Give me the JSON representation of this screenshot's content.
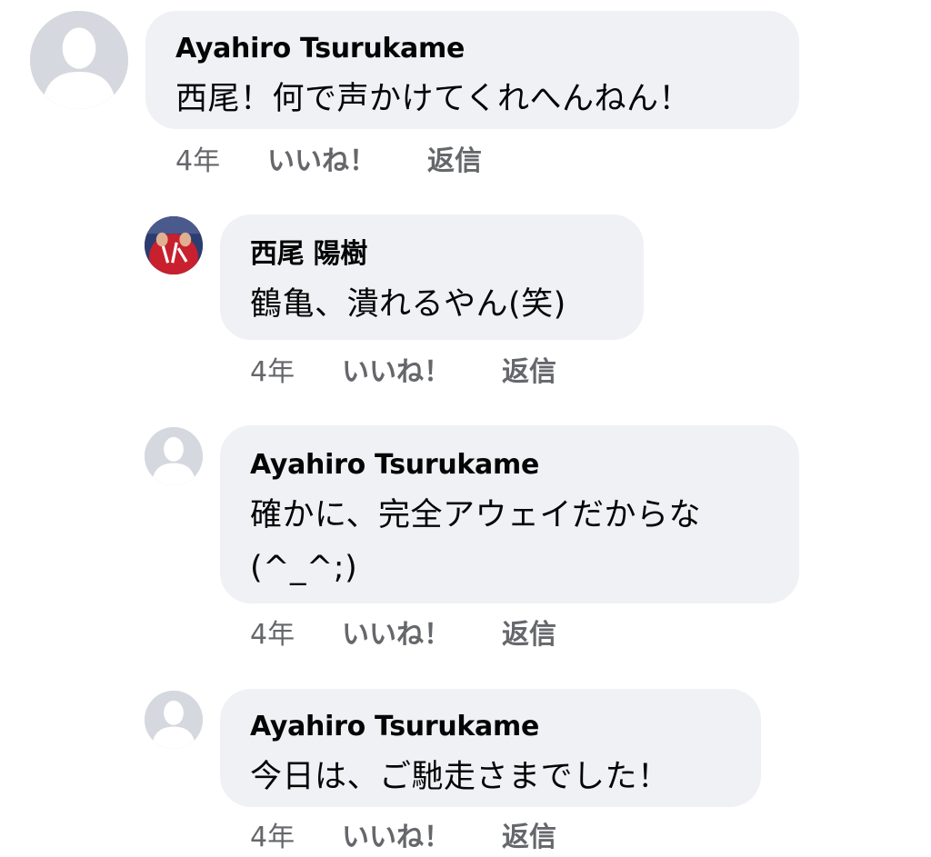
{
  "comments": [
    {
      "author": "Ayahiro Tsurukame",
      "avatar": "default-profile-icon",
      "lines": [
        "西尾！何で声かけてくれへんねん！"
      ],
      "time": "4年",
      "like_label": "いいね！",
      "reply_label": "返信"
    },
    {
      "author": "西尾 陽樹",
      "avatar": "profile-photo-red",
      "lines": [
        "鶴亀、潰れるやん(笑)"
      ],
      "time": "4年",
      "like_label": "いいね！",
      "reply_label": "返信"
    },
    {
      "author": "Ayahiro Tsurukame",
      "avatar": "default-profile-icon",
      "lines": [
        "確かに、完全アウェイだからな",
        "(^_^;)"
      ],
      "time": "4年",
      "like_label": "いいね！",
      "reply_label": "返信"
    },
    {
      "author": "Ayahiro Tsurukame",
      "avatar": "default-profile-icon",
      "lines": [
        "今日は、ご馳走さまでした！"
      ],
      "time": "4年",
      "like_label": "いいね！",
      "reply_label": "返信"
    }
  ],
  "colors": {
    "bubble": "#eff1f5",
    "meta_text": "#65676b",
    "default_avatar_bg": "#d5d8de",
    "photo_avatar_red": "#c8202e"
  }
}
